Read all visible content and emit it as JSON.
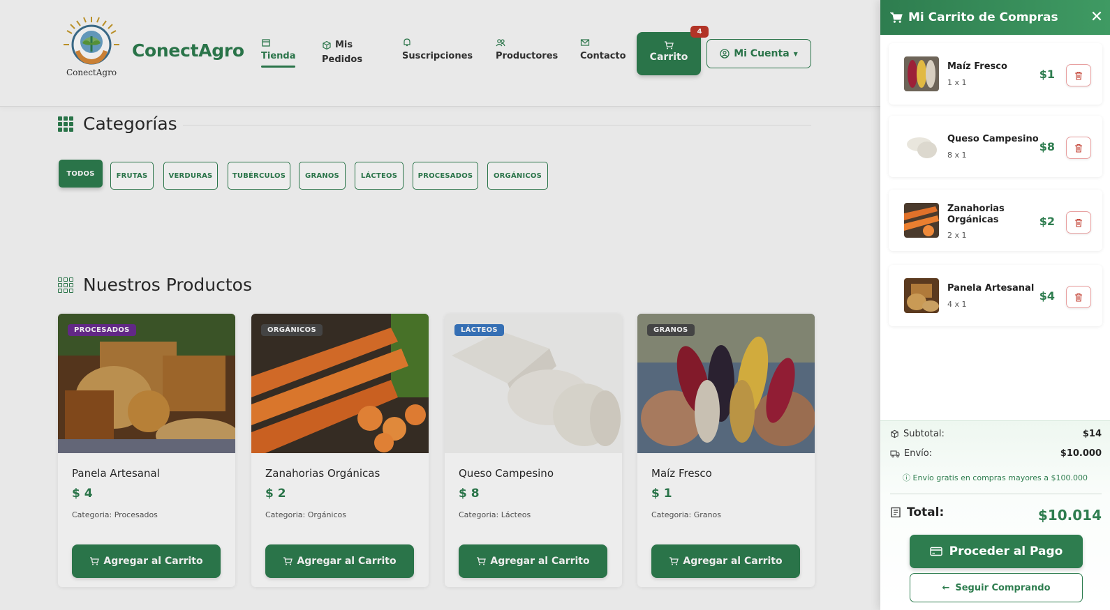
{
  "brand": {
    "name": "ConectAgro",
    "logo_text": "ConectAgro"
  },
  "nav": {
    "items": [
      {
        "label": "Tienda",
        "icon": "store-icon"
      },
      {
        "label": "Mis\nPedidos",
        "line1": "Mis",
        "line2": "Pedidos",
        "icon": "box-icon"
      },
      {
        "label": "Suscripciones",
        "icon": "bell-icon"
      },
      {
        "label": "Productores",
        "icon": "users-icon"
      },
      {
        "label": "Contacto",
        "icon": "mail-icon"
      }
    ],
    "cart_label": "Carrito",
    "cart_count": "4",
    "account_label": "Mi Cuenta"
  },
  "categories": {
    "title": "Categorías",
    "chips": [
      "TODOS",
      "FRUTAS",
      "VERDURAS",
      "TUBÉRCULOS",
      "GRANOS",
      "LÁCTEOS",
      "PROCESADOS",
      "ORGÁNICOS"
    ],
    "active": "TODOS"
  },
  "products": {
    "title": "Nuestros Productos",
    "items": [
      {
        "tag": "PROCESADOS",
        "tag_color": "#6a2c91",
        "name": "Panela Artesanal",
        "price": "$ 4",
        "category": "Categoria: Procesados",
        "button": "Agregar al Carrito"
      },
      {
        "tag": "ORGÁNICOS",
        "tag_color": "#4a4a4a",
        "name": "Zanahorias Orgánicas",
        "price": "$ 2",
        "category": "Categoria: Orgánicos",
        "button": "Agregar al Carrito"
      },
      {
        "tag": "LÁCTEOS",
        "tag_color": "#3a78c2",
        "name": "Queso Campesino",
        "price": "$ 8",
        "category": "Categoria: Lácteos",
        "button": "Agregar al Carrito"
      },
      {
        "tag": "GRANOS",
        "tag_color": "#4a4a4a",
        "name": "Maíz Fresco",
        "price": "$ 1",
        "category": "Categoria: Granos",
        "button": "Agregar al Carrito"
      }
    ]
  },
  "cart": {
    "title": "Mi Carrito de Compras",
    "items": [
      {
        "name": "Maíz Fresco",
        "qty": "1 x 1",
        "price": "$1"
      },
      {
        "name": "Queso Campesino",
        "qty": "8 x 1",
        "price": "$8"
      },
      {
        "name": "Zanahorias Orgánicas",
        "qty": "2 x 1",
        "price": "$2"
      },
      {
        "name": "Panela Artesanal",
        "qty": "4 x 1",
        "price": "$4"
      }
    ],
    "subtotal_label": "Subtotal:",
    "subtotal": "$14",
    "shipping_label": "Envío:",
    "shipping": "$10.000",
    "free_shipping_note": "Envío gratis en compras mayores a $100.000",
    "total_label": "Total:",
    "total": "$10.014",
    "pay_button": "Proceder al Pago",
    "continue_button": "Seguir Comprando"
  },
  "colors": {
    "primary": "#2e7d4f",
    "danger": "#c0392b"
  }
}
